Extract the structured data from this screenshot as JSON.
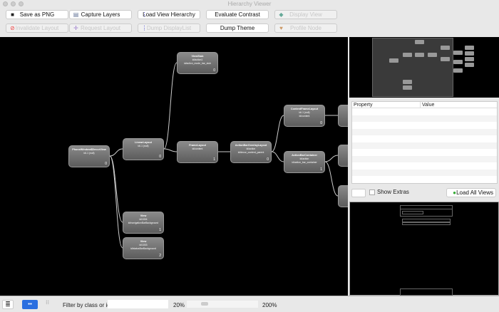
{
  "window": {
    "title": "Hierarchy Viewer"
  },
  "toolbar": {
    "row1": [
      {
        "label": "Save as PNG",
        "icon": "floppy-icon",
        "enabled": true
      },
      {
        "label": "Capture Layers",
        "icon": "layers-icon",
        "enabled": true
      },
      {
        "label": "Load View Hierarchy",
        "icon": "hierarchy-icon",
        "enabled": true
      },
      {
        "label": "Evaluate Contrast",
        "icon": "",
        "enabled": true
      },
      {
        "label": "Display View",
        "icon": "display-icon",
        "enabled": false
      }
    ],
    "row2": [
      {
        "label": "Invalidate Layout",
        "icon": "no-entry-icon",
        "enabled": false
      },
      {
        "label": "Request Layout",
        "icon": "request-icon",
        "enabled": false
      },
      {
        "label": "Dump DisplayList",
        "icon": "hierarchy-icon",
        "enabled": false
      },
      {
        "label": "Dump Theme",
        "icon": "",
        "enabled": true
      },
      {
        "label": "Profile Node",
        "icon": "profile-icon",
        "enabled": false
      }
    ]
  },
  "tree": {
    "nodes": [
      {
        "id": "decor",
        "name": "PhoneWindow$DecorView",
        "line1": "id/-1 (null)",
        "line2": "",
        "index": "0"
      },
      {
        "id": "linear",
        "name": "LinearLayout",
        "line1": "id/-1 (null)",
        "line2": "",
        "index": "0"
      },
      {
        "id": "stub",
        "name": "ViewStub",
        "line1": "id/action1",
        "line2": "id/action_mode_bar_stub",
        "index": "0"
      },
      {
        "id": "frame",
        "name": "FrameLayout",
        "line1": "id/content",
        "line2": "",
        "index": "1"
      },
      {
        "id": "overlay",
        "name": "ActionBarOverlayLayout",
        "line1": "id/action",
        "line2": "id/decor_content_parent",
        "index": "0"
      },
      {
        "id": "content",
        "name": "ContentFrameLayout",
        "line1": "id/-1 (null)",
        "line2": "id/content",
        "index": "0"
      },
      {
        "id": "abc",
        "name": "ActionBarContainer",
        "line1": "id/action",
        "line2": "id/action_bar_container",
        "index": "1"
      },
      {
        "id": "view1",
        "name": "View",
        "line1": "id/1004",
        "line2": "id/navigationBarBackground",
        "index": "1"
      },
      {
        "id": "view2",
        "name": "View",
        "line1": "id/1003",
        "line2": "id/statusBarBackground",
        "index": "2"
      }
    ]
  },
  "properties": {
    "col_property": "Property",
    "col_value": "Value"
  },
  "controls": {
    "show_extras": "Show Extras",
    "load_all_views": "Load All Views"
  },
  "status": {
    "filter_label": "Filter by class or id:",
    "filter_value": "",
    "zoom_min": "20%",
    "zoom_max": "200%",
    "zoom_fraction": 0.25
  }
}
